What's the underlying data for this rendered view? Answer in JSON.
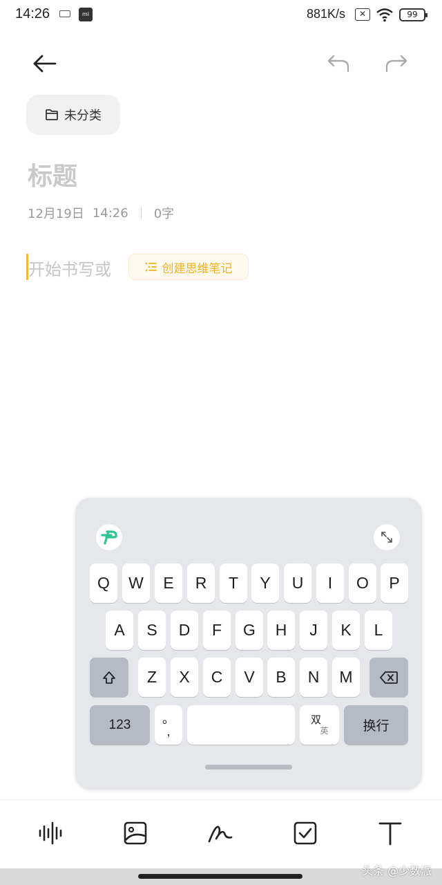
{
  "status_bar": {
    "time": "14:26",
    "network_speed": "881K/s",
    "battery": "99"
  },
  "note": {
    "category_label": "未分类",
    "title_placeholder": "标题",
    "date": "12月19日",
    "time": "14:26",
    "char_count": "0字",
    "body_placeholder": "开始书写或",
    "mindmap_label": "创建思维笔记"
  },
  "keyboard": {
    "row1": [
      "Q",
      "W",
      "E",
      "R",
      "T",
      "Y",
      "U",
      "I",
      "O",
      "P"
    ],
    "row2": [
      "A",
      "S",
      "D",
      "F",
      "G",
      "H",
      "J",
      "K",
      "L"
    ],
    "row3": [
      "Z",
      "X",
      "C",
      "V",
      "B",
      "N",
      "M"
    ],
    "numbers_key": "123",
    "punct_top": "。",
    "punct_bottom": ",",
    "lang_top": "双",
    "lang_bottom": "英",
    "enter_key": "换行"
  },
  "icons": {
    "back": "back-arrow-icon",
    "undo": "undo-icon",
    "redo": "redo-icon",
    "folder": "folder-icon",
    "list": "list-icon",
    "shift": "shift-icon",
    "backspace": "backspace-icon",
    "expand": "expand-icon",
    "voice": "voice-wave-icon",
    "image": "image-icon",
    "handwriting": "handwriting-icon",
    "checkbox": "checkbox-icon",
    "text_format": "text-format-icon"
  },
  "colors": {
    "accent": "#f0b21d",
    "keyboard_bg": "#e6e7eb",
    "logo_green": "#2fc495"
  },
  "watermark": "头条 @少数派"
}
